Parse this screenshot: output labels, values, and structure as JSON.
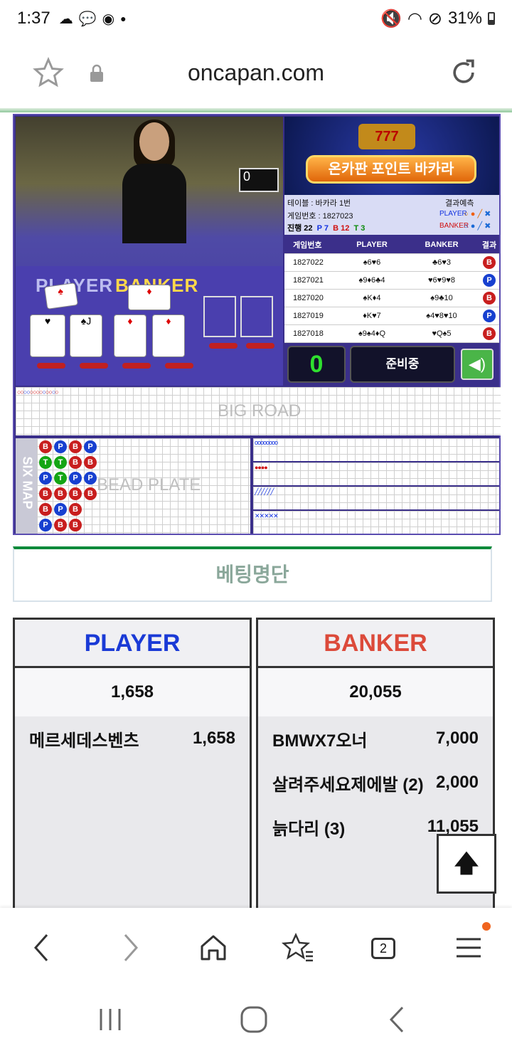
{
  "status": {
    "time": "1:37",
    "notif_icons": [
      "cloud-icon",
      "kakao-talk-icon",
      "chat-bubble-icon",
      "dot-icon"
    ],
    "battery": "31%"
  },
  "browser": {
    "url": "oncapan.com"
  },
  "game": {
    "video": {
      "player_label": "PLAYER",
      "banker_label": "BANKER",
      "screen_value": "0"
    },
    "banner_title": "온카판 포인트 바카라",
    "banner_slots": "777",
    "info": {
      "table": "테이블 : 바카라 1번",
      "game_number": "게임번호 : 1827023",
      "progress_label": "진행 22",
      "p_count": "P 7",
      "b_count": "B 12",
      "t_count": "T 3",
      "prediction_label": "결과예측",
      "player_pred": "PLAYER",
      "banker_pred": "BANKER"
    },
    "history": {
      "headers": [
        "게임번호",
        "PLAYER",
        "BANKER",
        "결과"
      ],
      "rows": [
        {
          "no": "1827022",
          "player": "♠6♥6",
          "banker": "♣6♥3",
          "result": "B"
        },
        {
          "no": "1827021",
          "player": "♠9♦6♣4",
          "banker": "♥6♥9♥8",
          "result": "P"
        },
        {
          "no": "1827020",
          "player": "♠K♦4",
          "banker": "♠9♣10",
          "result": "B"
        },
        {
          "no": "1827019",
          "player": "♦K♥7",
          "banker": "♠4♥8♥10",
          "result": "P"
        },
        {
          "no": "1827018",
          "player": "♠9♠4♦Q",
          "banker": "♥Q♠5",
          "result": "B"
        }
      ]
    },
    "control": {
      "count": "0",
      "state": "준비중",
      "sound_icon": "speaker-icon"
    },
    "big_road_label": "BIG ROAD",
    "six_map_label": "SIX MAP",
    "bead_plate_label": "BEAD PLATE",
    "bead": [
      [
        "B",
        "P",
        "B",
        "P"
      ],
      [
        "T",
        "T",
        "B",
        "B"
      ],
      [
        "P",
        "T",
        "P",
        "P"
      ],
      [
        "B",
        "B",
        "B",
        "B"
      ],
      [
        "B",
        "P",
        "B",
        ""
      ],
      [
        "P",
        "B",
        "B",
        ""
      ]
    ]
  },
  "betting": {
    "title": "베팅명단",
    "player": {
      "label": "PLAYER",
      "total": "1,658",
      "entries": [
        {
          "name": "메르세데스벤츠",
          "amount": "1,658"
        }
      ]
    },
    "banker": {
      "label": "BANKER",
      "total": "20,055",
      "entries": [
        {
          "name": "BMWX7오너",
          "amount": "7,000"
        },
        {
          "name": "살려주세요제에발 (2)",
          "amount": "2,000"
        },
        {
          "name": "늙다리 (3)",
          "amount": "11,055"
        }
      ]
    }
  },
  "bottom_nav": {
    "tabs_count": "2"
  },
  "colors": {
    "player": "#1a3ad6",
    "banker": "#dc4a3a",
    "accent_green": "#0a8a3a"
  }
}
